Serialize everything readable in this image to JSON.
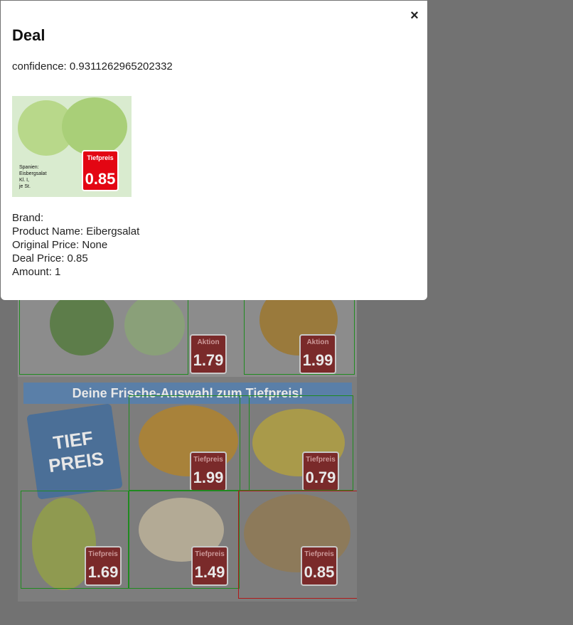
{
  "modal": {
    "title": "Deal",
    "close_glyph": "×",
    "confidence_line": "confidence: 0.9311262965202332",
    "thumbnail": {
      "tag_label": "Tiefpreis",
      "price": "0.85",
      "description": "Spanien:\nEisbergsalat\nKl. I,\nje St."
    },
    "fields": {
      "brand": "Brand: ",
      "product_name": "Product Name: Eibergsalat",
      "original_price": "Original Price: None",
      "deal_price": "Deal Price: 0.85",
      "amount": "Amount: 1"
    }
  },
  "flyer": {
    "banner": "Deine Frische-Auswahl zum Tiefpreis!",
    "arrow_text": [
      "TIEF",
      "PREIS"
    ],
    "tags": [
      {
        "label": "Aktion",
        "price": "1.79"
      },
      {
        "label": "Aktion",
        "price": "1.99"
      },
      {
        "label": "Tiefpreis",
        "price": "1.99"
      },
      {
        "label": "Tiefpreis",
        "price": "0.79"
      },
      {
        "label": "Tiefpreis",
        "price": "1.69"
      },
      {
        "label": "Tiefpreis",
        "price": "1.49"
      },
      {
        "label": "Tiefpreis",
        "price": "0.85"
      }
    ]
  },
  "colors": {
    "overlay": "#727272",
    "modal_bg": "#ffffff",
    "price_tag_red": "#e30613",
    "detection_green": "#1f8a1f",
    "detection_red": "#b01818"
  }
}
